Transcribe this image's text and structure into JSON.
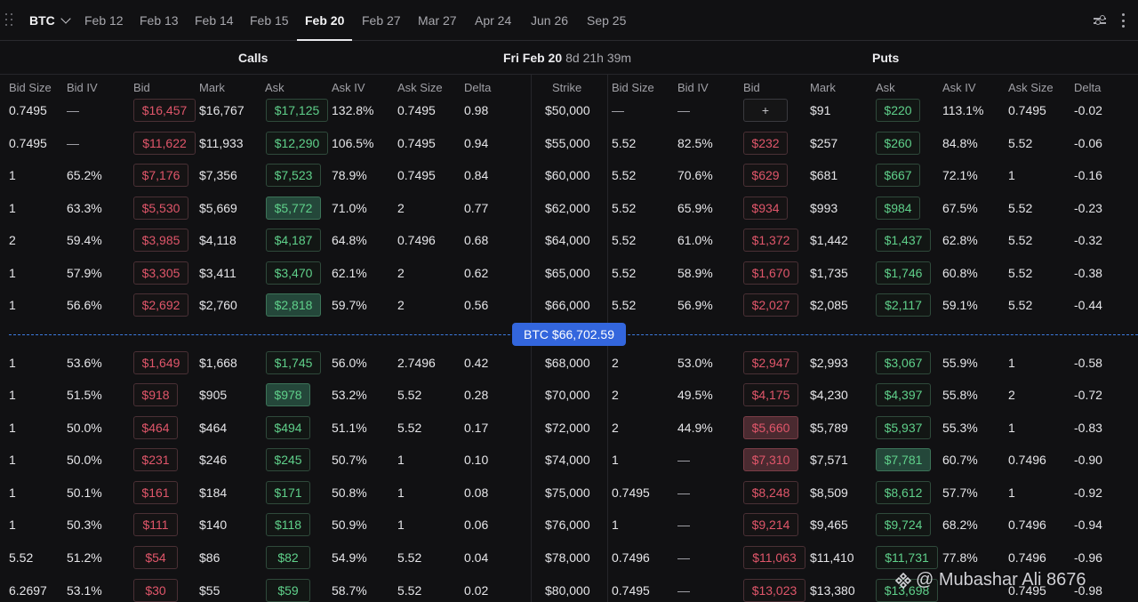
{
  "topbar": {
    "asset": "BTC",
    "tabs": [
      "Feb 12",
      "Feb 13",
      "Feb 14",
      "Feb 15",
      "Feb 20",
      "Feb 27",
      "Mar 27",
      "Apr 24",
      "Jun 26",
      "Sep 25"
    ],
    "active_tab": "Feb 20"
  },
  "section": {
    "calls": "Calls",
    "puts": "Puts",
    "expiry_date": "Fri Feb 20",
    "expiry_countdown": "8d 21h 39m"
  },
  "columns": {
    "calls": [
      "Bid Size",
      "Bid IV",
      "Bid",
      "Mark",
      "Ask",
      "Ask IV",
      "Ask Size",
      "Delta"
    ],
    "strike": "Strike",
    "puts": [
      "Bid Size",
      "Bid IV",
      "Bid",
      "Mark",
      "Ask",
      "Ask IV",
      "Ask Size",
      "Delta"
    ]
  },
  "spot": "BTC $66,702.59",
  "watermark": "@ Mubashar Ali 8676",
  "rows": [
    {
      "strike": "$50,000",
      "c_bid_size": "0.7495",
      "c_bid_iv": "—",
      "c_bid": "$16,457",
      "c_mark": "$16,767",
      "c_ask": "$17,125",
      "c_ask_iv": "132.8%",
      "c_ask_size": "0.7495",
      "c_delta": "0.98",
      "p_bid_size": "—",
      "p_bid_iv": "—",
      "p_bid": "+",
      "p_mark": "$91",
      "p_ask": "$220",
      "p_ask_iv": "113.1%",
      "p_ask_size": "0.7495",
      "p_delta": "-0.02"
    },
    {
      "strike": "$55,000",
      "c_bid_size": "0.7495",
      "c_bid_iv": "—",
      "c_bid": "$11,622",
      "c_mark": "$11,933",
      "c_ask": "$12,290",
      "c_ask_iv": "106.5%",
      "c_ask_size": "0.7495",
      "c_delta": "0.94",
      "p_bid_size": "5.52",
      "p_bid_iv": "82.5%",
      "p_bid": "$232",
      "p_mark": "$257",
      "p_ask": "$260",
      "p_ask_iv": "84.8%",
      "p_ask_size": "5.52",
      "p_delta": "-0.06"
    },
    {
      "strike": "$60,000",
      "c_bid_size": "1",
      "c_bid_iv": "65.2%",
      "c_bid": "$7,176",
      "c_mark": "$7,356",
      "c_ask": "$7,523",
      "c_ask_iv": "78.9%",
      "c_ask_size": "0.7495",
      "c_delta": "0.84",
      "p_bid_size": "5.52",
      "p_bid_iv": "70.6%",
      "p_bid": "$629",
      "p_mark": "$681",
      "p_ask": "$667",
      "p_ask_iv": "72.1%",
      "p_ask_size": "1",
      "p_delta": "-0.16"
    },
    {
      "strike": "$62,000",
      "c_bid_size": "1",
      "c_bid_iv": "63.3%",
      "c_bid": "$5,530",
      "c_mark": "$5,669",
      "c_ask": "$5,772",
      "c_ask_iv": "71.0%",
      "c_ask_size": "2",
      "c_delta": "0.77",
      "p_bid_size": "5.52",
      "p_bid_iv": "65.9%",
      "p_bid": "$934",
      "p_mark": "$993",
      "p_ask": "$984",
      "p_ask_iv": "67.5%",
      "p_ask_size": "5.52",
      "p_delta": "-0.23"
    },
    {
      "strike": "$64,000",
      "c_bid_size": "2",
      "c_bid_iv": "59.4%",
      "c_bid": "$3,985",
      "c_mark": "$4,118",
      "c_ask": "$4,187",
      "c_ask_iv": "64.8%",
      "c_ask_size": "0.7496",
      "c_delta": "0.68",
      "p_bid_size": "5.52",
      "p_bid_iv": "61.0%",
      "p_bid": "$1,372",
      "p_mark": "$1,442",
      "p_ask": "$1,437",
      "p_ask_iv": "62.8%",
      "p_ask_size": "5.52",
      "p_delta": "-0.32"
    },
    {
      "strike": "$65,000",
      "c_bid_size": "1",
      "c_bid_iv": "57.9%",
      "c_bid": "$3,305",
      "c_mark": "$3,411",
      "c_ask": "$3,470",
      "c_ask_iv": "62.1%",
      "c_ask_size": "2",
      "c_delta": "0.62",
      "p_bid_size": "5.52",
      "p_bid_iv": "58.9%",
      "p_bid": "$1,670",
      "p_mark": "$1,735",
      "p_ask": "$1,746",
      "p_ask_iv": "60.8%",
      "p_ask_size": "5.52",
      "p_delta": "-0.38"
    },
    {
      "strike": "$66,000",
      "c_bid_size": "1",
      "c_bid_iv": "56.6%",
      "c_bid": "$2,692",
      "c_mark": "$2,760",
      "c_ask": "$2,818",
      "c_ask_iv": "59.7%",
      "c_ask_size": "2",
      "c_delta": "0.56",
      "p_bid_size": "5.52",
      "p_bid_iv": "56.9%",
      "p_bid": "$2,027",
      "p_mark": "$2,085",
      "p_ask": "$2,117",
      "p_ask_iv": "59.1%",
      "p_ask_size": "5.52",
      "p_delta": "-0.44"
    },
    {
      "strike": "$68,000",
      "c_bid_size": "1",
      "c_bid_iv": "53.6%",
      "c_bid": "$1,649",
      "c_mark": "$1,668",
      "c_ask": "$1,745",
      "c_ask_iv": "56.0%",
      "c_ask_size": "2.7496",
      "c_delta": "0.42",
      "p_bid_size": "2",
      "p_bid_iv": "53.0%",
      "p_bid": "$2,947",
      "p_mark": "$2,993",
      "p_ask": "$3,067",
      "p_ask_iv": "55.9%",
      "p_ask_size": "1",
      "p_delta": "-0.58"
    },
    {
      "strike": "$70,000",
      "c_bid_size": "1",
      "c_bid_iv": "51.5%",
      "c_bid": "$918",
      "c_mark": "$905",
      "c_ask": "$978",
      "c_ask_iv": "53.2%",
      "c_ask_size": "5.52",
      "c_delta": "0.28",
      "p_bid_size": "2",
      "p_bid_iv": "49.5%",
      "p_bid": "$4,175",
      "p_mark": "$4,230",
      "p_ask": "$4,397",
      "p_ask_iv": "55.8%",
      "p_ask_size": "2",
      "p_delta": "-0.72"
    },
    {
      "strike": "$72,000",
      "c_bid_size": "1",
      "c_bid_iv": "50.0%",
      "c_bid": "$464",
      "c_mark": "$464",
      "c_ask": "$494",
      "c_ask_iv": "51.1%",
      "c_ask_size": "5.52",
      "c_delta": "0.17",
      "p_bid_size": "2",
      "p_bid_iv": "44.9%",
      "p_bid": "$5,660",
      "p_mark": "$5,789",
      "p_ask": "$5,937",
      "p_ask_iv": "55.3%",
      "p_ask_size": "1",
      "p_delta": "-0.83"
    },
    {
      "strike": "$74,000",
      "c_bid_size": "1",
      "c_bid_iv": "50.0%",
      "c_bid": "$231",
      "c_mark": "$246",
      "c_ask": "$245",
      "c_ask_iv": "50.7%",
      "c_ask_size": "1",
      "c_delta": "0.10",
      "p_bid_size": "1",
      "p_bid_iv": "—",
      "p_bid": "$7,310",
      "p_mark": "$7,571",
      "p_ask": "$7,781",
      "p_ask_iv": "60.7%",
      "p_ask_size": "0.7496",
      "p_delta": "-0.90"
    },
    {
      "strike": "$75,000",
      "c_bid_size": "1",
      "c_bid_iv": "50.1%",
      "c_bid": "$161",
      "c_mark": "$184",
      "c_ask": "$171",
      "c_ask_iv": "50.8%",
      "c_ask_size": "1",
      "c_delta": "0.08",
      "p_bid_size": "0.7495",
      "p_bid_iv": "—",
      "p_bid": "$8,248",
      "p_mark": "$8,509",
      "p_ask": "$8,612",
      "p_ask_iv": "57.7%",
      "p_ask_size": "1",
      "p_delta": "-0.92"
    },
    {
      "strike": "$76,000",
      "c_bid_size": "1",
      "c_bid_iv": "50.3%",
      "c_bid": "$111",
      "c_mark": "$140",
      "c_ask": "$118",
      "c_ask_iv": "50.9%",
      "c_ask_size": "1",
      "c_delta": "0.06",
      "p_bid_size": "1",
      "p_bid_iv": "—",
      "p_bid": "$9,214",
      "p_mark": "$9,465",
      "p_ask": "$9,724",
      "p_ask_iv": "68.2%",
      "p_ask_size": "0.7496",
      "p_delta": "-0.94"
    },
    {
      "strike": "$78,000",
      "c_bid_size": "5.52",
      "c_bid_iv": "51.2%",
      "c_bid": "$54",
      "c_mark": "$86",
      "c_ask": "$82",
      "c_ask_iv": "54.9%",
      "c_ask_size": "5.52",
      "c_delta": "0.04",
      "p_bid_size": "0.7496",
      "p_bid_iv": "—",
      "p_bid": "$11,063",
      "p_mark": "$11,410",
      "p_ask": "$11,731",
      "p_ask_iv": "77.8%",
      "p_ask_size": "0.7496",
      "p_delta": "-0.96"
    },
    {
      "strike": "$80,000",
      "c_bid_size": "6.2697",
      "c_bid_iv": "53.1%",
      "c_bid": "$30",
      "c_mark": "$55",
      "c_ask": "$59",
      "c_ask_iv": "58.7%",
      "c_ask_size": "5.52",
      "c_delta": "0.02",
      "p_bid_size": "0.7495",
      "p_bid_iv": "—",
      "p_bid": "$13,023",
      "p_mark": "$13,380",
      "p_ask": "$13,698",
      "p_ask_iv": "",
      "p_ask_size": "0.7495",
      "p_delta": "-0.98"
    }
  ]
}
